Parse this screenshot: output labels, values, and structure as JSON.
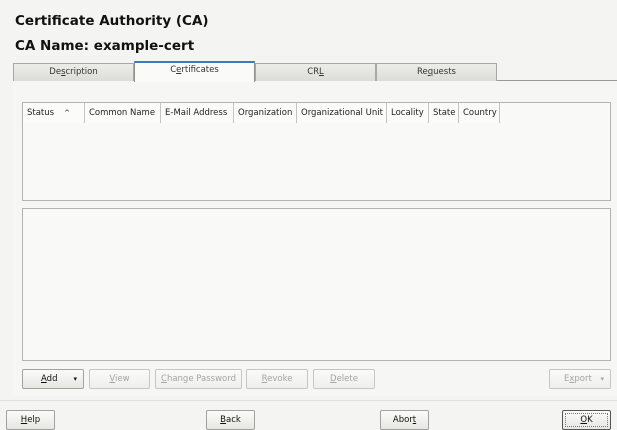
{
  "window": {
    "title": "Certificate Authority (CA)",
    "subtitle": "CA Name: example-cert"
  },
  "tabs": [
    {
      "pre": "De",
      "ul": "s",
      "post": "cription"
    },
    {
      "pre": "C",
      "ul": "e",
      "post": "rtificates"
    },
    {
      "pre": "CR",
      "ul": "L",
      "post": ""
    },
    {
      "pre": "Re",
      "ul": "q",
      "post": "uests"
    }
  ],
  "table": {
    "columns": [
      "Status",
      "Common Name",
      "E-Mail Address",
      "Organization",
      "Organizational Unit",
      "Locality",
      "State",
      "Country"
    ],
    "sort_indicator": "^"
  },
  "actions": {
    "add": {
      "pre": "",
      "ul": "A",
      "post": "dd",
      "arrow": "▾"
    },
    "view": {
      "pre": "",
      "ul": "V",
      "post": "iew"
    },
    "change_password": {
      "pre": "",
      "ul": "C",
      "post": "hange Password"
    },
    "revoke": {
      "pre": "",
      "ul": "R",
      "post": "evoke"
    },
    "delete": {
      "pre": "",
      "ul": "D",
      "post": "elete"
    },
    "export": {
      "pre": "E",
      "ul": "x",
      "post": "port",
      "arrow": "▾"
    }
  },
  "footer": {
    "help": {
      "pre": "",
      "ul": "H",
      "post": "elp"
    },
    "back": {
      "pre": "",
      "ul": "B",
      "post": "ack"
    },
    "abort": {
      "pre": "Abor",
      "ul": "t",
      "post": ""
    },
    "ok": {
      "pre": "",
      "ul": "O",
      "post": "K"
    }
  }
}
